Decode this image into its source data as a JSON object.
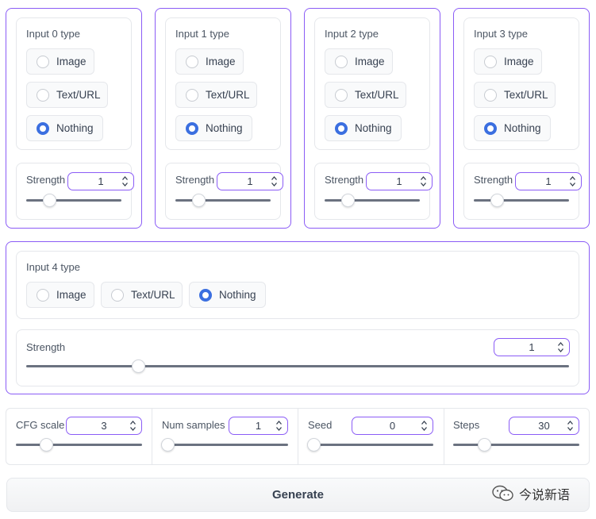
{
  "inputs": [
    {
      "type_label": "Input 0 type",
      "options": [
        "Image",
        "Text/URL",
        "Nothing"
      ],
      "selected": "Nothing",
      "strength_label": "Strength",
      "strength_value": "1"
    },
    {
      "type_label": "Input 1 type",
      "options": [
        "Image",
        "Text/URL",
        "Nothing"
      ],
      "selected": "Nothing",
      "strength_label": "Strength",
      "strength_value": "1"
    },
    {
      "type_label": "Input 2 type",
      "options": [
        "Image",
        "Text/URL",
        "Nothing"
      ],
      "selected": "Nothing",
      "strength_label": "Strength",
      "strength_value": "1"
    },
    {
      "type_label": "Input 3 type",
      "options": [
        "Image",
        "Text/URL",
        "Nothing"
      ],
      "selected": "Nothing",
      "strength_label": "Strength",
      "strength_value": "1"
    },
    {
      "type_label": "Input 4 type",
      "options": [
        "Image",
        "Text/URL",
        "Nothing"
      ],
      "selected": "Nothing",
      "strength_label": "Strength",
      "strength_value": "1"
    }
  ],
  "params": [
    {
      "label": "CFG scale",
      "value": "3"
    },
    {
      "label": "Num samples",
      "value": "1"
    },
    {
      "label": "Seed",
      "value": "0"
    },
    {
      "label": "Steps",
      "value": "30"
    }
  ],
  "generate_label": "Generate",
  "watermark_text": "今说新语",
  "accent_color": "#8b5cf6",
  "radio_checked_color": "#3b6fe0"
}
